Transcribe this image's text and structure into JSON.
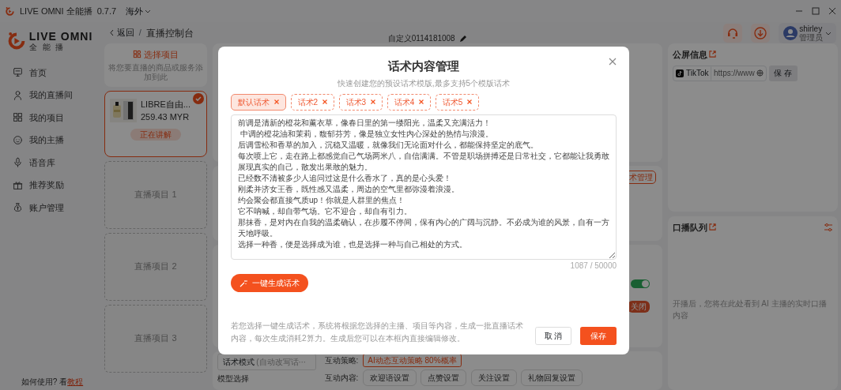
{
  "app": {
    "name": "LIVE OMNI 全能播",
    "version": "0.7.7",
    "region": "海外"
  },
  "header": {
    "back": "返回",
    "separator": "/",
    "breadcrumb": "直播控制台",
    "session_name": "自定义0114181008",
    "user": {
      "name": "shirley",
      "role": "管理员"
    }
  },
  "logo": {
    "text": "LIVE OMNI",
    "subtitle": "全 能 播"
  },
  "sidebar": {
    "items": [
      {
        "label": "首页"
      },
      {
        "label": "我的直播间"
      },
      {
        "label": "我的项目"
      },
      {
        "label": "我的主播"
      },
      {
        "label": "语音库"
      },
      {
        "label": "推荐奖励"
      },
      {
        "label": "账户管理"
      }
    ],
    "help": "如何使用? 看",
    "help_link": "教程"
  },
  "projects": {
    "add": {
      "title": "选择项目",
      "hint": "将您要直播的商品或服务添加到此"
    },
    "current": {
      "name": "LIBRE自由...",
      "price": "259.43 MYR",
      "status": "正在讲解",
      "selected": true
    },
    "slots": [
      "直播项目 1",
      "直播项目 2",
      "直播项目 3"
    ]
  },
  "settings": {
    "script_manage": "术管理",
    "toggle": {
      "on": true
    },
    "off_badge": "关闭",
    "script_mode": "话术模式",
    "script_mode_value": "(自动改写话⋯",
    "model_label": "模型选择",
    "strategy_label": "互动策略:",
    "strategy": "AI动态互动策略 80%概率",
    "content_label": "互动内容:",
    "content_buttons": [
      "欢迎语设置",
      "点赞设置",
      "关注设置",
      "礼物回复设置"
    ]
  },
  "public_screen": {
    "title": "公屏信息",
    "platform": "TikTok",
    "url": "https://www",
    "save": "保 存"
  },
  "queue": {
    "title": "口播队列",
    "empty": "开播后，您将在此处看到 AI 主播的实时口播内容"
  },
  "modal": {
    "title": "话术内容管理",
    "subtitle": "快速创建您的预设话术模版,最多支持5个模版话术",
    "tabs": [
      {
        "label": "默认话术",
        "selected": true
      },
      {
        "label": "话术2",
        "selected": false
      },
      {
        "label": "话术3",
        "selected": false
      },
      {
        "label": "话术4",
        "selected": false
      },
      {
        "label": "话术5",
        "selected": false
      }
    ],
    "script_lines": [
      "前调是清新的橙花和薰衣草，像春日里的第一缕阳光，温柔又充满活力！",
      " 中调的橙花油和茉莉，馥郁芬芳，像是独立女性内心深处的热情与浪漫。",
      "后调雪松和香草的加入，沉稳又温暖，就像我们无论面对什么，都能保持坚定的底气。",
      "每次喷上它，走在路上都感觉自己气场两米八，自信满满。不管是职场拼搏还是日常社交，它都能让我勇敢展现真实的自己，散发出果敢的魅力。",
      "已经数不清被多少人追问过这是什么香水了，真的是心头爱！",
      "刚柔并济女王香，既性感又温柔，周边的空气里都弥漫着浪漫。",
      "约会聚会都直接气质up！你就是人群里的焦点！",
      "它不呐喊，却自带气场。它不迎合，却自有引力。",
      "那抹香，是对内在自我的温柔确认，在步履不停间，保有内心的广阔与沉静。不必成为谁的风景，自有一方天地呼吸。",
      "选择一种香，便是选择成为谁，也是选择一种与自己相处的方式。"
    ],
    "counter": "1087 / 50000",
    "generate": "一键生成话术",
    "note": "若您选择一键生成话术，系统将根据您选择的主播、项目等内容，生成一批直播话术内容，每次生成消耗2算力。生成后您可以在本框内直接编辑修改。",
    "cancel": "取 消",
    "save": "保存"
  }
}
